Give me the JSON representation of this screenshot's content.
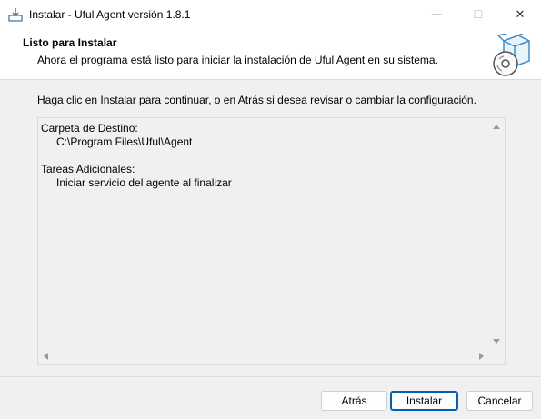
{
  "window": {
    "title": "Instalar - Uful Agent versión 1.8.1",
    "minimize_glyph": "—",
    "maximize_glyph": "☐",
    "close_glyph": "✕"
  },
  "header": {
    "title": "Listo para Instalar",
    "subtitle": "Ahora el programa está listo para iniciar la instalación de Uful Agent en su sistema."
  },
  "instructions": "Haga clic en Instalar para continuar, o en Atrás si desea revisar o cambiar la configuración.",
  "memo": {
    "lines": [
      "Carpeta de Destino:",
      "C:\\Program Files\\Uful\\Agent",
      "",
      "Tareas Adicionales:",
      "Iniciar servicio del agente al finalizar"
    ]
  },
  "buttons": {
    "back": "Atrás",
    "install": "Instalar",
    "cancel": "Cancelar"
  },
  "icons": {
    "app": "installer-icon",
    "header": "box-with-disc-icon"
  },
  "colors": {
    "accent": "#005fb8",
    "background": "#f0f0f0",
    "header_bg": "#ffffff"
  }
}
